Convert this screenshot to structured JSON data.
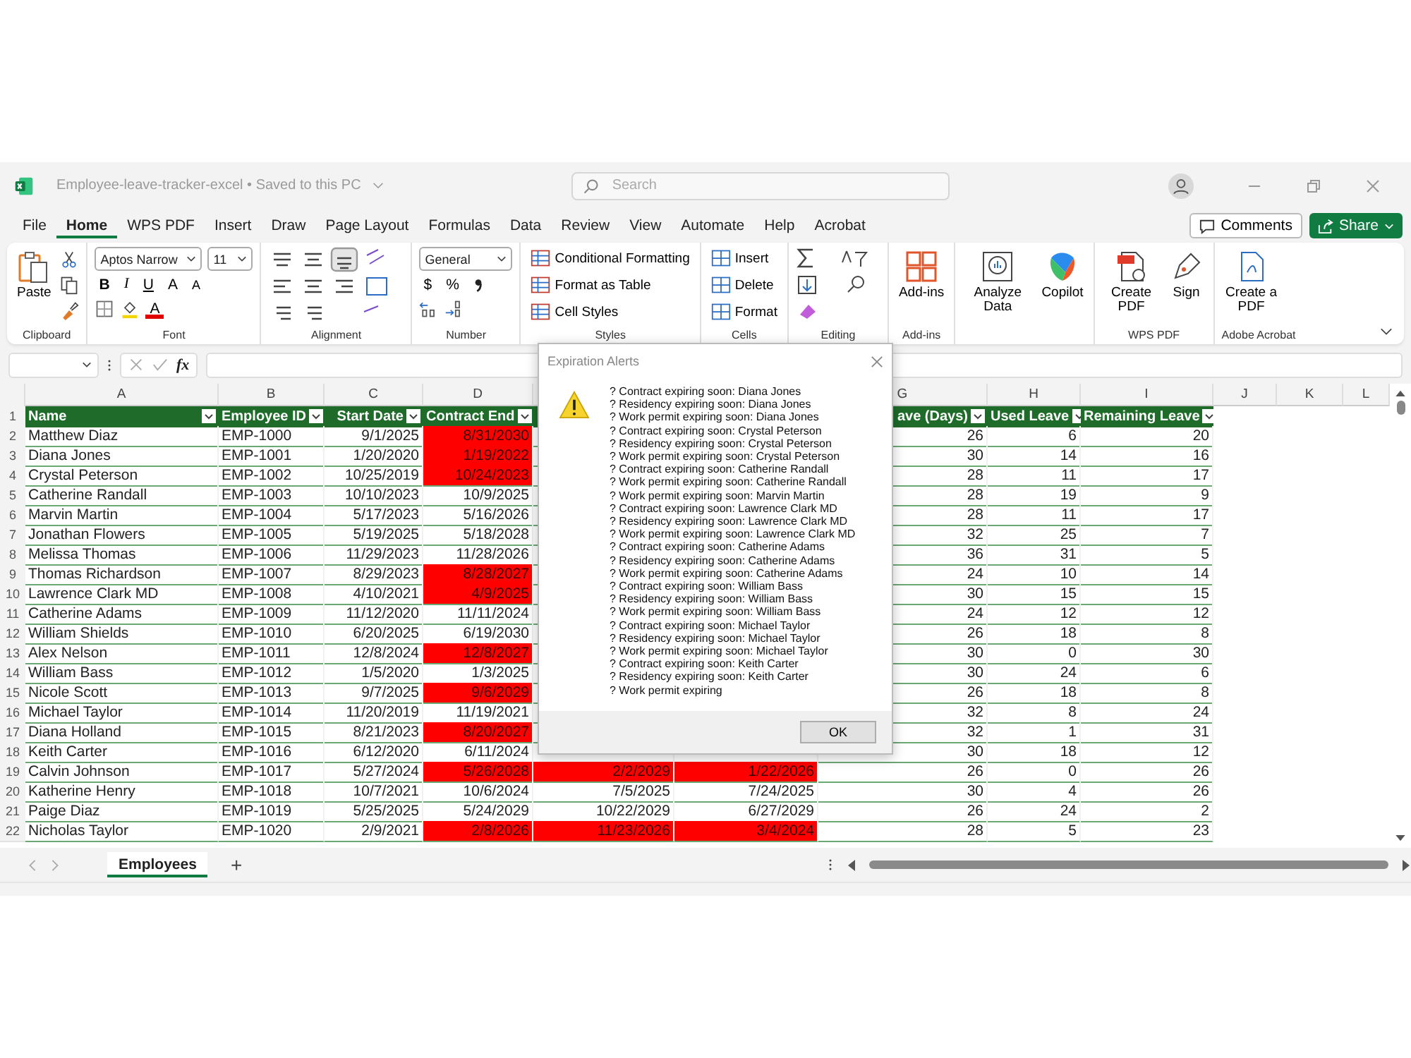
{
  "window": {
    "title": "Employee-leave-tracker-excel",
    "separator": "•",
    "save_status": "Saved to this PC",
    "search_placeholder": "Search"
  },
  "menu_tabs": [
    {
      "label": "File",
      "selected": false
    },
    {
      "label": "Home",
      "selected": true
    },
    {
      "label": "WPS PDF",
      "selected": false
    },
    {
      "label": "Insert",
      "selected": false
    },
    {
      "label": "Draw",
      "selected": false
    },
    {
      "label": "Page Layout",
      "selected": false
    },
    {
      "label": "Formulas",
      "selected": false
    },
    {
      "label": "Data",
      "selected": false
    },
    {
      "label": "Review",
      "selected": false
    },
    {
      "label": "View",
      "selected": false
    },
    {
      "label": "Automate",
      "selected": false
    },
    {
      "label": "Help",
      "selected": false
    },
    {
      "label": "Acrobat",
      "selected": false
    }
  ],
  "comments_button": "Comments",
  "share_button": "Share",
  "ribbon": {
    "clipboard": {
      "label": "Clipboard",
      "paste": "Paste"
    },
    "font": {
      "label": "Font",
      "family": "Aptos Narrow",
      "size": "11",
      "bold": "B",
      "italic": "I",
      "underline": "U",
      "grow": "A",
      "shrink": "A",
      "color_button": "A"
    },
    "alignment": {
      "label": "Alignment"
    },
    "number": {
      "label": "Number",
      "format": "General",
      "currency": "$",
      "percent": "%"
    },
    "styles": {
      "label": "Styles",
      "items": [
        "Conditional Formatting",
        "Format as Table",
        "Cell Styles"
      ]
    },
    "cells": {
      "label": "Cells",
      "items": [
        "Insert",
        "Delete",
        "Format"
      ]
    },
    "editing": {
      "label": "Editing"
    },
    "addins": {
      "label": "Add-ins",
      "button": "Add-ins"
    },
    "ai": {
      "buttons": [
        "Analyze Data",
        "Copilot"
      ]
    },
    "wps": {
      "label": "WPS PDF",
      "buttons": [
        "Create PDF",
        "Sign"
      ]
    },
    "acrobat": {
      "label": "Adobe Acrobat",
      "button": "Create a PDF"
    }
  },
  "formula_bar": {
    "fx": "fx"
  },
  "column_letters": [
    "A",
    "B",
    "C",
    "D",
    "G",
    "H",
    "I",
    "J",
    "K",
    "L"
  ],
  "header_row": {
    "num": "1",
    "headers": [
      "Name",
      "Employee ID",
      "Start Date",
      "Contract End",
      "ave (Days)",
      "Used Leave",
      "Remaining Leave"
    ]
  },
  "rows": [
    {
      "num": "2",
      "name": "Matthew Diaz",
      "id": "EMP-1000",
      "start": "9/1/2025",
      "contract_end": "8/31/2030",
      "contract_alert": true,
      "leave": "26",
      "used": "6",
      "remaining": "20"
    },
    {
      "num": "3",
      "name": "Diana Jones",
      "id": "EMP-1001",
      "start": "1/20/2020",
      "contract_end": "1/19/2022",
      "contract_alert": true,
      "leave": "30",
      "used": "14",
      "remaining": "16"
    },
    {
      "num": "4",
      "name": "Crystal Peterson",
      "id": "EMP-1002",
      "start": "10/25/2019",
      "contract_end": "10/24/2023",
      "contract_alert": true,
      "leave": "28",
      "used": "11",
      "remaining": "17"
    },
    {
      "num": "5",
      "name": "Catherine Randall",
      "id": "EMP-1003",
      "start": "10/10/2023",
      "contract_end": "10/9/2025",
      "contract_alert": false,
      "leave": "28",
      "used": "19",
      "remaining": "9"
    },
    {
      "num": "6",
      "name": "Marvin Martin",
      "id": "EMP-1004",
      "start": "5/17/2023",
      "contract_end": "5/16/2026",
      "contract_alert": false,
      "leave": "28",
      "used": "11",
      "remaining": "17"
    },
    {
      "num": "7",
      "name": "Jonathan Flowers",
      "id": "EMP-1005",
      "start": "5/19/2025",
      "contract_end": "5/18/2028",
      "contract_alert": false,
      "leave": "32",
      "used": "25",
      "remaining": "7"
    },
    {
      "num": "8",
      "name": "Melissa Thomas",
      "id": "EMP-1006",
      "start": "11/29/2023",
      "contract_end": "11/28/2026",
      "contract_alert": false,
      "leave": "36",
      "used": "31",
      "remaining": "5"
    },
    {
      "num": "9",
      "name": "Thomas Richardson",
      "id": "EMP-1007",
      "start": "8/29/2023",
      "contract_end": "8/28/2027",
      "contract_alert": true,
      "leave": "24",
      "used": "10",
      "remaining": "14"
    },
    {
      "num": "10",
      "name": "Lawrence Clark MD",
      "id": "EMP-1008",
      "start": "4/10/2021",
      "contract_end": "4/9/2025",
      "contract_alert": true,
      "leave": "30",
      "used": "15",
      "remaining": "15"
    },
    {
      "num": "11",
      "name": "Catherine Adams",
      "id": "EMP-1009",
      "start": "11/12/2020",
      "contract_end": "11/11/2024",
      "contract_alert": false,
      "leave": "24",
      "used": "12",
      "remaining": "12"
    },
    {
      "num": "12",
      "name": "William Shields",
      "id": "EMP-1010",
      "start": "6/20/2025",
      "contract_end": "6/19/2030",
      "contract_alert": false,
      "leave": "26",
      "used": "18",
      "remaining": "8"
    },
    {
      "num": "13",
      "name": "Alex Nelson",
      "id": "EMP-1011",
      "start": "12/8/2024",
      "contract_end": "12/8/2027",
      "contract_alert": true,
      "leave": "30",
      "used": "0",
      "remaining": "30"
    },
    {
      "num": "14",
      "name": "William Bass",
      "id": "EMP-1012",
      "start": "1/5/2020",
      "contract_end": "1/3/2025",
      "contract_alert": false,
      "leave": "30",
      "used": "24",
      "remaining": "6"
    },
    {
      "num": "15",
      "name": "Nicole Scott",
      "id": "EMP-1013",
      "start": "9/7/2025",
      "contract_end": "9/6/2029",
      "contract_alert": true,
      "leave": "26",
      "used": "18",
      "remaining": "8"
    },
    {
      "num": "16",
      "name": "Michael Taylor",
      "id": "EMP-1014",
      "start": "11/20/2019",
      "contract_end": "11/19/2021",
      "contract_alert": false,
      "leave": "32",
      "used": "8",
      "remaining": "24"
    },
    {
      "num": "17",
      "name": "Diana Holland",
      "id": "EMP-1015",
      "start": "8/21/2023",
      "contract_end": "8/20/2027",
      "contract_alert": true,
      "leave": "32",
      "used": "1",
      "remaining": "31"
    },
    {
      "num": "18",
      "name": "Keith Carter",
      "id": "EMP-1016",
      "start": "6/12/2020",
      "contract_end": "6/11/2024",
      "contract_alert": false,
      "leave": "30",
      "used": "18",
      "remaining": "12"
    },
    {
      "num": "19",
      "name": "Calvin Johnson",
      "id": "EMP-1017",
      "start": "5/27/2024",
      "contract_end": "5/26/2028",
      "contract_alert": true,
      "residency_end": "2/2/2029",
      "residency_alert": true,
      "permit_end": "1/22/2026",
      "permit_alert": true,
      "leave": "26",
      "used": "0",
      "remaining": "26"
    },
    {
      "num": "20",
      "name": "Katherine Henry",
      "id": "EMP-1018",
      "start": "10/7/2021",
      "contract_end": "10/6/2024",
      "contract_alert": false,
      "residency_end": "7/5/2025",
      "residency_alert": false,
      "permit_end": "7/24/2025",
      "permit_alert": false,
      "leave": "30",
      "used": "4",
      "remaining": "26"
    },
    {
      "num": "21",
      "name": "Paige Diaz",
      "id": "EMP-1019",
      "start": "5/25/2025",
      "contract_end": "5/24/2029",
      "contract_alert": false,
      "residency_end": "10/22/2029",
      "residency_alert": false,
      "permit_end": "6/27/2029",
      "permit_alert": false,
      "leave": "26",
      "used": "24",
      "remaining": "2"
    },
    {
      "num": "22",
      "name": "Nicholas Taylor",
      "id": "EMP-1020",
      "start": "2/9/2021",
      "contract_end": "2/8/2026",
      "contract_alert": true,
      "residency_end": "11/23/2026",
      "residency_alert": true,
      "permit_end": "3/4/2024",
      "permit_alert": true,
      "leave": "28",
      "used": "5",
      "remaining": "23"
    }
  ],
  "sheets": [
    {
      "label": "Employees",
      "selected": true
    }
  ],
  "add_sheet": "+",
  "dialog": {
    "title": "Expiration Alerts",
    "button": "OK",
    "lines": [
      "? Contract expiring soon: Diana Jones",
      "? Residency expiring soon: Diana Jones",
      "? Work permit expiring soon: Diana Jones",
      "? Contract expiring soon: Crystal Peterson",
      "? Residency expiring soon: Crystal Peterson",
      "? Work permit expiring soon: Crystal Peterson",
      "? Contract expiring soon: Catherine Randall",
      "? Work permit expiring soon: Catherine Randall",
      "? Work permit expiring soon: Marvin Martin",
      "? Contract expiring soon: Lawrence Clark MD",
      "? Residency expiring soon: Lawrence Clark MD",
      "? Work permit expiring soon: Lawrence Clark MD",
      "? Contract expiring soon: Catherine Adams",
      "? Residency expiring soon: Catherine Adams",
      "? Work permit expiring soon: Catherine Adams",
      "? Contract expiring soon: William Bass",
      "? Residency expiring soon: William Bass",
      "? Work permit expiring soon: William Bass",
      "? Contract expiring soon: Michael Taylor",
      "? Residency expiring soon: Michael Taylor",
      "? Work permit expiring soon: Michael Taylor",
      "? Contract expiring soon: Keith Carter",
      "? Residency expiring soon: Keith Carter",
      "? Work permit expiring"
    ]
  }
}
